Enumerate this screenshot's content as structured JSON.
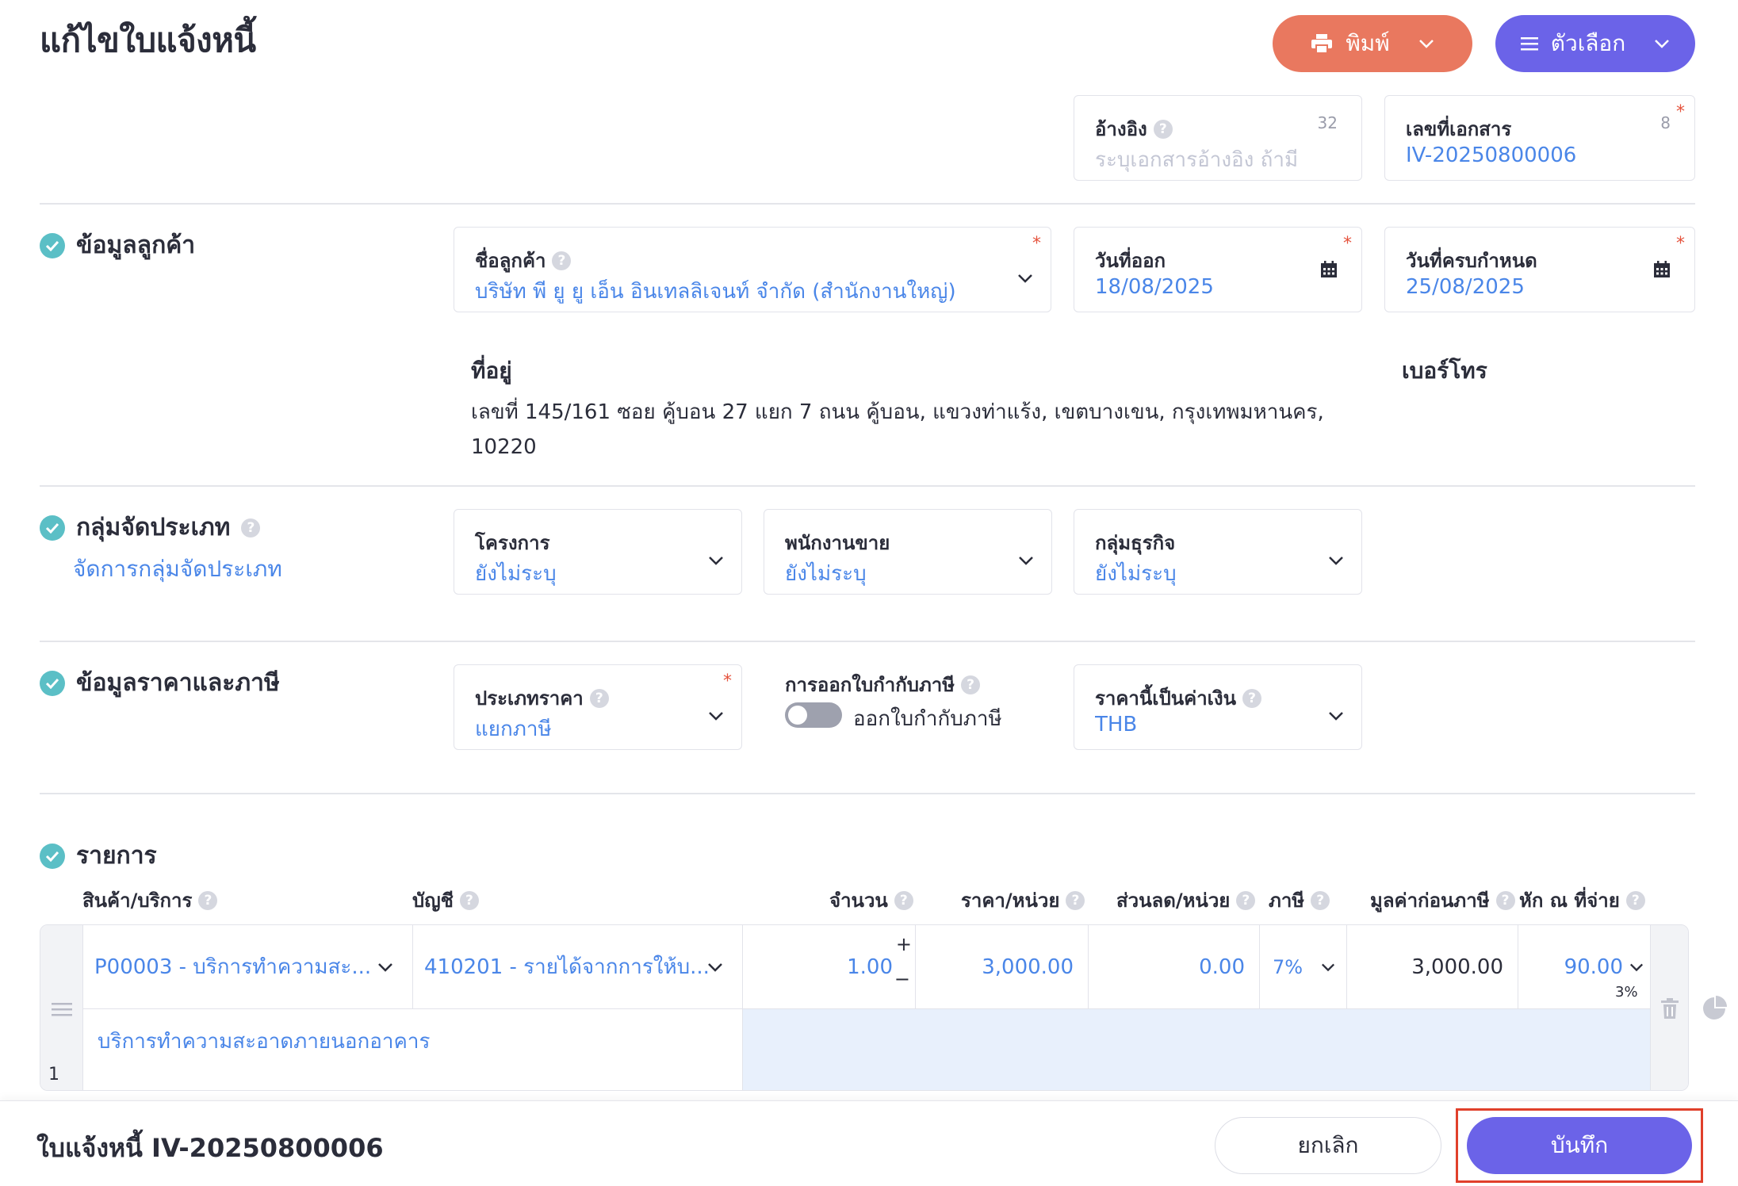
{
  "header": {
    "title": "แก้ไขใบแจ้งหนี้",
    "print_label": "พิมพ์",
    "options_label": "ตัวเลือก"
  },
  "reference": {
    "label": "อ้างอิง",
    "placeholder": "ระบุเอกสารอ้างอิง ถ้ามี",
    "count": "32"
  },
  "doc_no": {
    "label": "เลขที่เอกสาร",
    "value": "IV-20250800006",
    "count": "8",
    "required": "*"
  },
  "customer_section": {
    "title": "ข้อมูลลูกค้า",
    "customer_label": "ชื่อลูกค้า",
    "customer_value": "บริษัท พี ยู ยู เอ็น อินเทลลิเจนท์ จำกัด (สำนักงานใหญ่)",
    "issue_date_label": "วันที่ออก",
    "issue_date": "18/08/2025",
    "due_date_label": "วันที่ครบกำหนด",
    "due_date": "25/08/2025",
    "address_label": "ที่อยู่",
    "address": "เลขที่ 145/161 ซอย คู้บอน 27 แยก 7 ถนน คู้บอน, แขวงท่าแร้ง, เขตบางเขน, กรุงเทพมหานคร, 10220",
    "phone_label": "เบอร์โทร",
    "required": "*"
  },
  "group_section": {
    "title": "กลุ่มจัดประเภท",
    "manage_link": "จัดการกลุ่มจัดประเภท",
    "project_label": "โครงการ",
    "project_value": "ยังไม่ระบุ",
    "salesperson_label": "พนักงานขาย",
    "salesperson_value": "ยังไม่ระบุ",
    "business_label": "กลุ่มธุรกิจ",
    "business_value": "ยังไม่ระบุ"
  },
  "price_section": {
    "title": "ข้อมูลราคาและภาษี",
    "price_type_label": "ประเภทราคา",
    "price_type_value": "แยกภาษี",
    "tax_invoice_label": "การออกใบกำกับภาษี",
    "tax_invoice_toggle_label": "ออกใบกำกับภาษี",
    "currency_label": "ราคานี้เป็นค่าเงิน",
    "currency_value": "THB",
    "required": "*"
  },
  "items_section": {
    "title": "รายการ",
    "columns": {
      "product": "สินค้า/บริการ",
      "account": "บัญชี",
      "qty": "จำนวน",
      "price": "ราคา/หน่วย",
      "discount": "ส่วนลด/หน่วย",
      "tax": "ภาษี",
      "pretax": "มูลค่าก่อนภาษี",
      "wht": "หัก ณ ที่จ่าย"
    },
    "rows": [
      {
        "index": "1",
        "product": "P00003 - บริการทำความสะ...",
        "account": "410201 - รายได้จากการให้บ...",
        "qty": "1.00",
        "price": "3,000.00",
        "discount": "0.00",
        "tax": "7%",
        "pretax": "3,000.00",
        "wht": "90.00",
        "wht_rate": "3%",
        "description": "บริการทำความสะอาดภายนอกอาคาร"
      }
    ]
  },
  "footer": {
    "doc_title": "ใบแจ้งหนี้ IV-20250800006",
    "cancel_label": "ยกเลิก",
    "save_label": "บันทึก"
  },
  "colors": {
    "print_button": "#e9785f",
    "primary": "#6b63e8",
    "link": "#4a86e8",
    "section_check": "#5bbfc6",
    "highlight": "#e0402b"
  }
}
